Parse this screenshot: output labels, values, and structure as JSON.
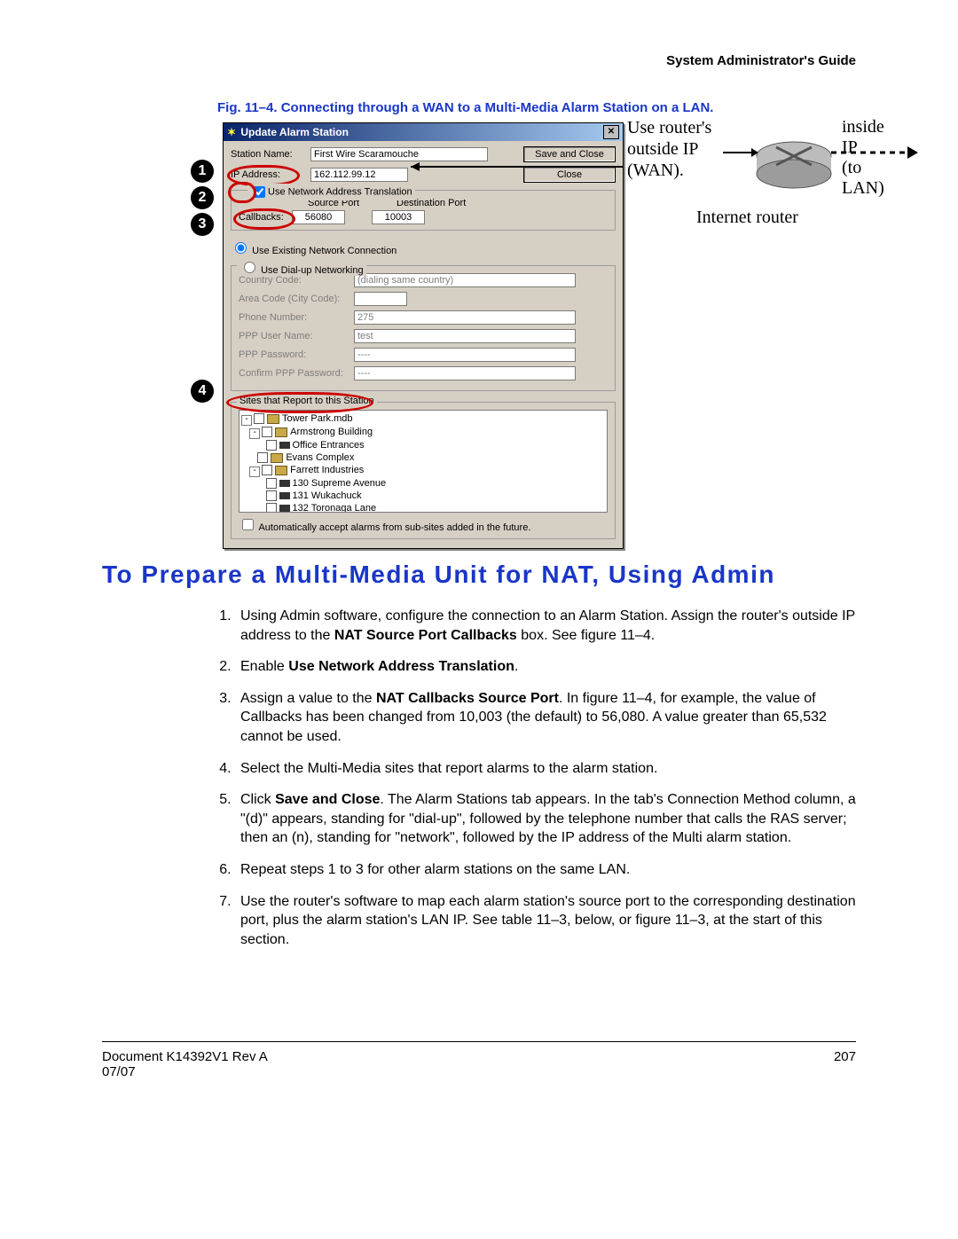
{
  "header": {
    "right": "System Administrator's Guide"
  },
  "figure": {
    "caption": "Fig. 11–4.   Connecting through a WAN to a Multi-Media Alarm Station on a LAN.",
    "numbers": [
      "1",
      "2",
      "3",
      "4"
    ],
    "dialog": {
      "title": "Update Alarm Station",
      "station_name_lbl": "Station Name:",
      "station_name_val": "First Wire Scaramouche",
      "ip_lbl": "IP Address:",
      "ip_val": "162.112.99.12",
      "save_btn": "Save and Close",
      "close_btn": "Close",
      "use_nat_label": "Use Network Address Translation",
      "source_port_lbl": "Source Port",
      "dest_port_lbl": "Destination Port",
      "callbacks_lbl": "Callbacks:",
      "callbacks_src": "56080",
      "callbacks_dst": "10003",
      "use_existing": "Use Existing Network Connection",
      "use_dialup": "Use Dial-up Networking",
      "country_lbl": "Country Code:",
      "country_val": "(dialing same country)",
      "area_lbl": "Area Code (City Code):",
      "phone_lbl": "Phone Number:",
      "phone_val": "275",
      "ppp_user_lbl": "PPP User Name:",
      "ppp_user_val": "test",
      "ppp_pw_lbl": "PPP Password:",
      "ppp_pw_val": "----",
      "confirm_pw_lbl": "Confirm PPP Password:",
      "confirm_pw_val": "----",
      "sites_lbl": "Sites that Report to this Station",
      "tree": {
        "l1": "Tower Park.mdb",
        "l2": "Armstrong Building",
        "l3": "Office Entrances",
        "l4": "Evans Complex",
        "l5": "Farrett Industries",
        "l6": "130 Supreme Avenue",
        "l7": "131 Wukachuck",
        "l8": "132 Toronaga Lane"
      },
      "auto_accept": "Automatically accept alarms from sub-sites added in the future."
    },
    "router": {
      "line1": "Use router's",
      "line2": "outside IP",
      "line3": "(WAN).",
      "inside": "inside IP",
      "tolan": "(to LAN)",
      "caption": "Internet router"
    }
  },
  "heading": "To Prepare a Multi-Media Unit for NAT, Using Admin",
  "steps": [
    "Using Admin software, configure the connection to an Alarm Station. Assign the router's outside IP address to the <b>NAT Source Port Callbacks</b> box. See figure 11–4.",
    "Enable <b>Use Network Address Translation</b>.",
    "Assign a value to the <b>NAT Callbacks Source Port</b>. In figure 11–4, for example, the value of Callbacks has been changed from 10,003 (the default) to 56,080. A value greater than 65,532 cannot be used.",
    "Select the Multi-Media sites that report alarms to the alarm station.",
    "Click <b>Save and Close</b>. The Alarm Stations tab appears. In the tab's Connection Method column, a \"(d)\" appears, standing for \"dial-up\", followed by the telephone number that calls the RAS server; then an (n), standing for \"network\", followed by the IP address of the Multi alarm station.",
    "Repeat steps 1 to 3 for other alarm stations on the same LAN.",
    "Use the router's software to map each alarm station's source port to the corresponding destination port, plus the alarm station's LAN IP. See table 11–3, below, or figure 11–3, at the start of this section."
  ],
  "footer": {
    "doc": "Document K14392V1 Rev A",
    "date": "07/07",
    "page": "207"
  }
}
